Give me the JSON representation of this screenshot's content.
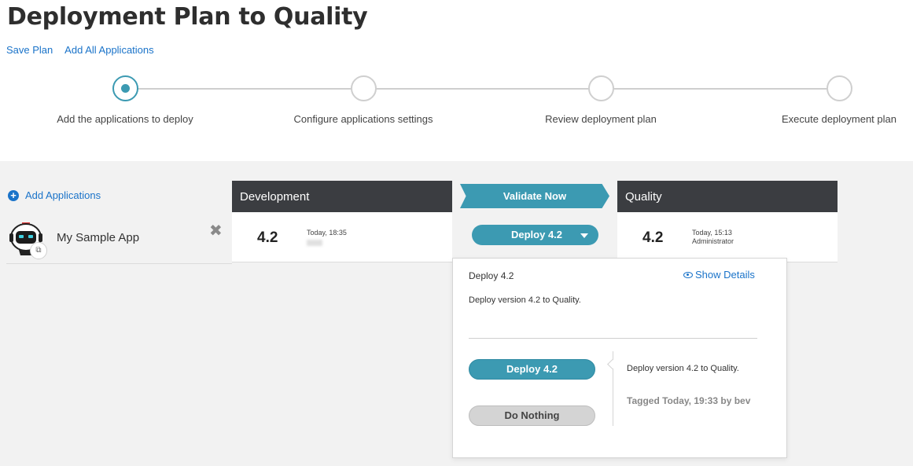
{
  "page": {
    "title": "Deployment Plan to Quality"
  },
  "top_links": {
    "save_plan": "Save Plan",
    "add_all_applications": "Add All Applications"
  },
  "wizard": {
    "steps": [
      {
        "label": "Add the applications to deploy",
        "active": true
      },
      {
        "label": "Configure applications settings",
        "active": false
      },
      {
        "label": "Review deployment plan",
        "active": false
      },
      {
        "label": "Execute deployment plan",
        "active": false
      }
    ]
  },
  "left": {
    "add_applications": "Add Applications",
    "app": {
      "name": "My Sample App",
      "icon": "robot-app-icon"
    }
  },
  "source_env": {
    "name": "Development",
    "version": "4.2",
    "timestamp": "Today, 18:35"
  },
  "middle": {
    "validate_label": "Validate Now",
    "deploy_label": "Deploy 4.2"
  },
  "target_env": {
    "name": "Quality",
    "version": "4.2",
    "timestamp": "Today, 15:13",
    "user": "Administrator"
  },
  "popup": {
    "title": "Deploy 4.2",
    "show_details": "Show Details",
    "description": "Deploy version 4.2 to Quality.",
    "options": {
      "deploy_label": "Deploy 4.2",
      "nothing_label": "Do Nothing"
    },
    "option_description": "Deploy version 4.2 to Quality.",
    "tag_info": "Tagged Today, 19:33 by bev"
  },
  "colors": {
    "accent": "#3c9ab2",
    "link": "#1a73c9",
    "header_dark": "#3b3d41"
  }
}
